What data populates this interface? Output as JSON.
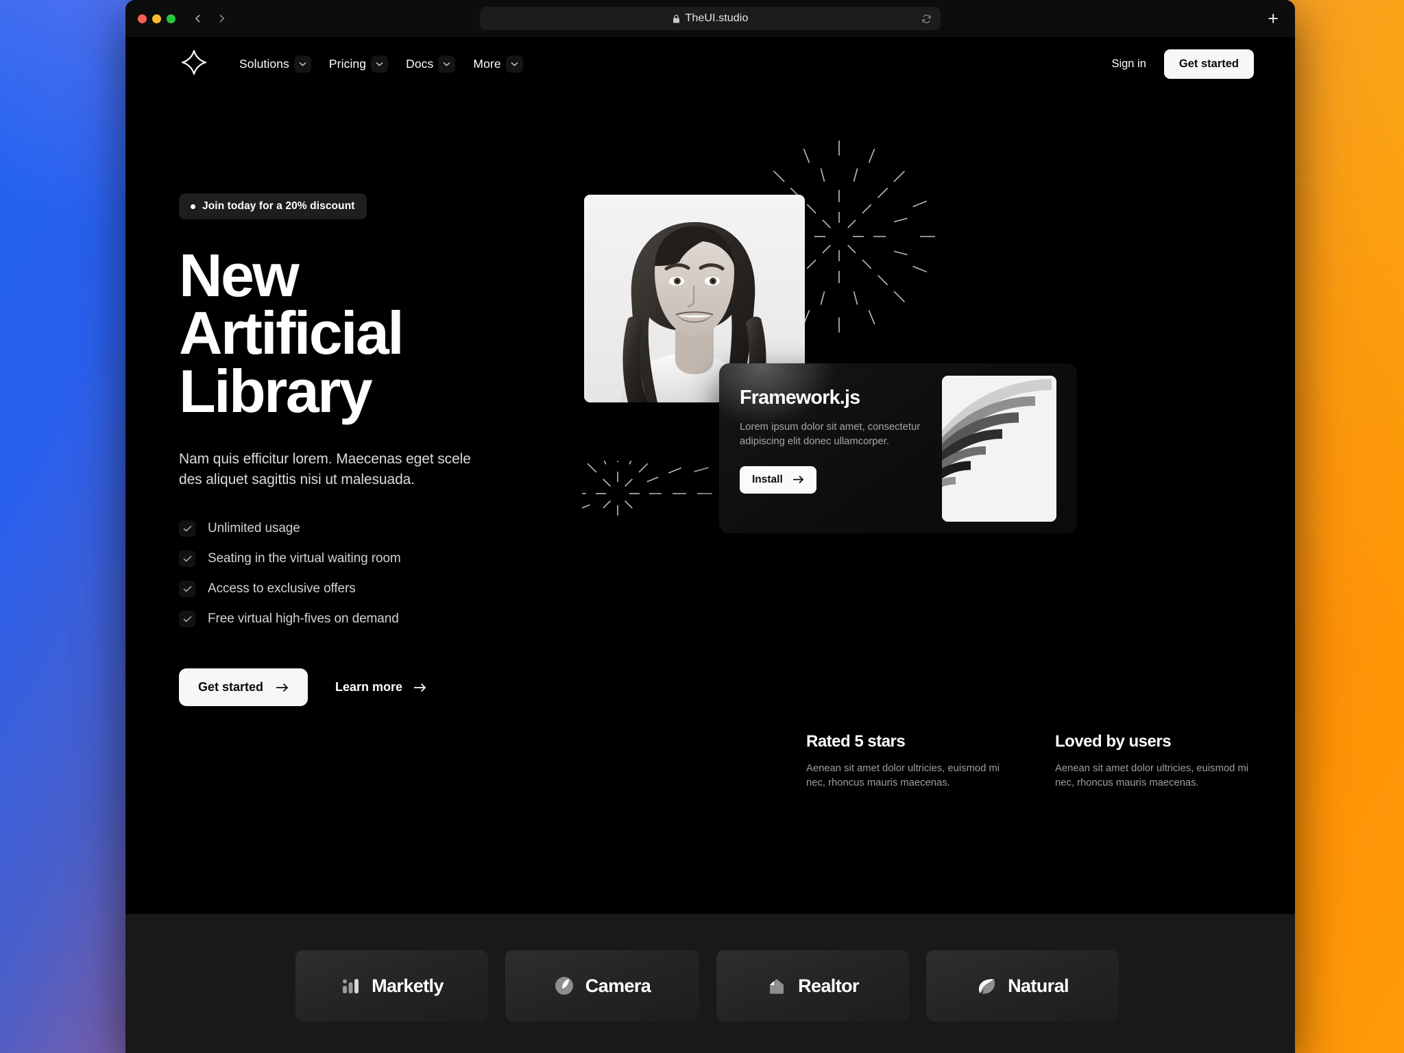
{
  "browser": {
    "url": "TheUI.studio",
    "lock_icon": "lock-icon",
    "reload_icon": "reload-icon",
    "new_tab_label": "+",
    "back_icon": "chevron-left-icon",
    "forward_icon": "chevron-right-icon"
  },
  "nav": {
    "logo_icon": "four-point-star-logo",
    "items": [
      {
        "label": "Solutions",
        "chevron": "chevron-down-icon"
      },
      {
        "label": "Pricing",
        "chevron": "chevron-down-icon"
      },
      {
        "label": "Docs",
        "chevron": "chevron-down-icon"
      },
      {
        "label": "More",
        "chevron": "chevron-down-icon"
      }
    ],
    "signin_label": "Sign in",
    "get_started_label": "Get started"
  },
  "hero": {
    "badge": "Join today for a 20% discount",
    "headline_line1": "New",
    "headline_line2": "Artificial",
    "headline_line3": "Library",
    "subtext": "Nam quis efficitur lorem. Maecenas eget scele des aliquet sagittis nisi ut malesuada.",
    "checklist": [
      "Unlimited usage",
      "Seating in the virtual waiting room",
      "Access to exclusive offers",
      "Free virtual high-fives on demand"
    ],
    "cta_primary": "Get started",
    "cta_secondary": "Learn more"
  },
  "framework_card": {
    "title": "Framework.js",
    "description": "Lorem ipsum dolor sit amet, consectetur adipiscing elit donec ullamcorper.",
    "install_label": "Install"
  },
  "stats": [
    {
      "title": "Rated 5 stars",
      "description": "Aenean sit amet dolor ultricies, euismod mi nec, rhoncus mauris maecenas."
    },
    {
      "title": "Loved by users",
      "description": "Aenean sit amet dolor ultricies, euismod mi nec, rhoncus mauris maecenas."
    }
  ],
  "brands": [
    {
      "name": "Marketly",
      "icon": "bar-chart-icon"
    },
    {
      "name": "Camera",
      "icon": "aperture-icon"
    },
    {
      "name": "Realtor",
      "icon": "house-icon"
    },
    {
      "name": "Natural",
      "icon": "leaf-icon"
    }
  ],
  "colors": {
    "page_background": "#000000",
    "strip_background": "#191919",
    "accent_light": "#f7f7f7",
    "muted_text": "#9e9e9e"
  }
}
